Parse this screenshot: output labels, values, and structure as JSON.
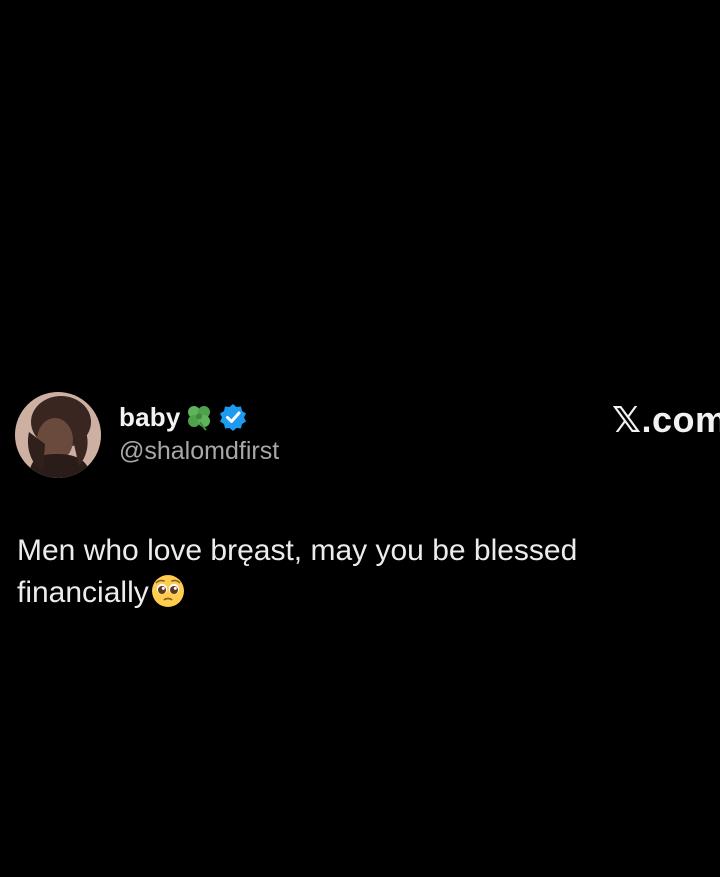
{
  "tweet": {
    "display_name": "baby",
    "name_emoji_icon": "four-leaf-clover-icon",
    "verified_icon": "verified-badge-icon",
    "handle": "@shalomdfirst",
    "brand_x": "𝕏",
    "brand_domain": ".com",
    "text_line1": "Men who love bręast, may you be blessed",
    "text_line2": "financially",
    "trailing_emoji_icon": "pleading-face-icon"
  },
  "colors": {
    "background": "#000000",
    "name_text": "#f2f2f2",
    "handle_text": "#a8a8a8",
    "verified_blue": "#1d9bf0",
    "clover_green": "#5fb35a"
  }
}
